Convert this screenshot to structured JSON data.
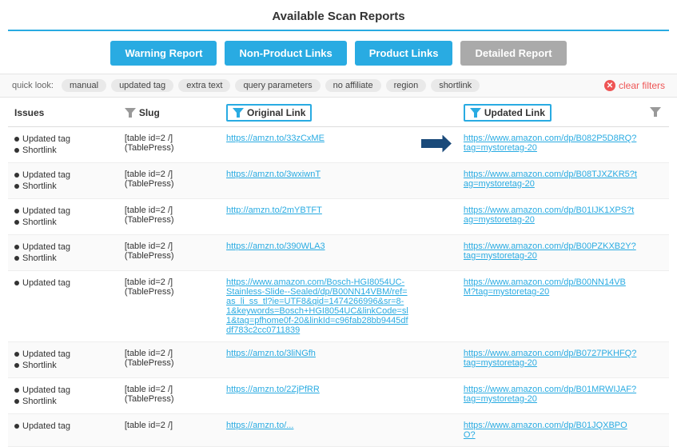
{
  "header": {
    "title": "Available Scan Reports"
  },
  "buttons": [
    {
      "label": "Warning Report",
      "type": "warning"
    },
    {
      "label": "Non-Product Links",
      "type": "nonproduct"
    },
    {
      "label": "Product Links",
      "type": "product"
    },
    {
      "label": "Detailed Report",
      "type": "detailed"
    }
  ],
  "quicklook": {
    "label": "quick look:",
    "tags": [
      "manual",
      "updated tag",
      "extra text",
      "query parameters",
      "no affiliate",
      "region",
      "shortlink"
    ],
    "clear_label": "clear filters"
  },
  "table": {
    "columns": {
      "issues": "Issues",
      "slug": "Slug",
      "original": "Original Link",
      "updated": "Updated Link"
    },
    "rows": [
      {
        "issues": [
          "Updated tag",
          "Shortlink"
        ],
        "slug": "[table id=2 /] (TablePress)",
        "original": "https://amzn.to/33zCxME",
        "updated": "https://www.amazon.com/dp/B082P5D8RQ?tag=mystoretag-20"
      },
      {
        "issues": [
          "Updated tag",
          "Shortlink"
        ],
        "slug": "[table id=2 /] (TablePress)",
        "original": "https://amzn.to/3wxiwnT",
        "updated": "https://www.amazon.com/dp/B08TJXZKR5?tag=mystoretag-20"
      },
      {
        "issues": [
          "Updated tag",
          "Shortlink"
        ],
        "slug": "[table id=2 /] (TablePress)",
        "original": "http://amzn.to/2mYBTFT",
        "updated": "https://www.amazon.com/dp/B01IJK1XPS?tag=mystoretag-20"
      },
      {
        "issues": [
          "Updated tag",
          "Shortlink"
        ],
        "slug": "[table id=2 /] (TablePress)",
        "original": "https://amzn.to/390WLA3",
        "updated": "https://www.amazon.com/dp/B00PZKXB2Y?tag=mystoretag-20"
      },
      {
        "issues": [
          "Updated tag"
        ],
        "slug": "[table id=2 /] (TablePress)",
        "original": "https://www.amazon.com/Bosch-HGI8054UC-Stainless-Slide--Sealed/dp/B00NN14VBM/ref=as_li_ss_tl?ie=UTF8&qid=1474266996&sr=8-1&keywords=Bosch+HGI8054UC&linkCode=sl1&tag=pfhome0f-20&linkId=c96fab28bb9445dfdf783c2cc0711839",
        "updated": "https://www.amazon.com/dp/B00NN14VBM?tag=mystoretag-20"
      },
      {
        "issues": [
          "Updated tag",
          "Shortlink"
        ],
        "slug": "[table id=2 /] (TablePress)",
        "original": "https://amzn.to/3liNGfh",
        "updated": "https://www.amazon.com/dp/B0727PKHFQ?tag=mystoretag-20"
      },
      {
        "issues": [
          "Updated tag",
          "Shortlink"
        ],
        "slug": "[table id=2 /] (TablePress)",
        "original": "https://amzn.to/2ZjPfRR",
        "updated": "https://www.amazon.com/dp/B01MRWIJAF?tag=mystoretag-20"
      },
      {
        "issues": [
          "Updated tag"
        ],
        "slug": "[table id=2 /]",
        "original": "https://amzn.to/...",
        "updated": "https://www.amazon.com/dp/B01JQXBPOO?"
      }
    ]
  }
}
